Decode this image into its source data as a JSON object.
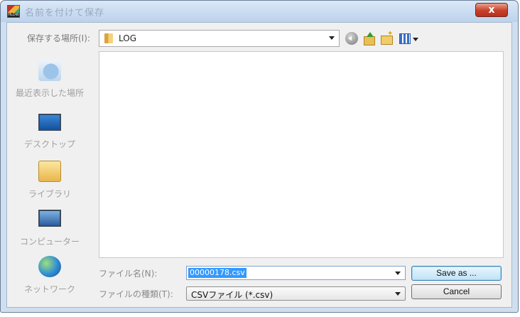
{
  "window": {
    "title": "名前を付けて保存",
    "app_icon_text": "HLDW",
    "close_label": "x"
  },
  "toolbar": {
    "save_in_label": "保存する場所(I):",
    "location_value": "LOG",
    "icons": [
      "back-icon",
      "up-folder-icon",
      "new-folder-icon",
      "views-menu-icon"
    ]
  },
  "places": [
    {
      "label": "最近表示した場所",
      "icon": "recent-places-icon"
    },
    {
      "label": "デスクトップ",
      "icon": "desktop-icon"
    },
    {
      "label": "ライブラリ",
      "icon": "library-icon"
    },
    {
      "label": "コンピューター",
      "icon": "computer-icon"
    },
    {
      "label": "ネットワーク",
      "icon": "network-icon"
    }
  ],
  "form": {
    "filename_label": "ファイル名(N):",
    "filename_value": "00000178.csv",
    "filetype_label": "ファイルの種類(T):",
    "filetype_value": "CSVファイル (*.csv)"
  },
  "buttons": {
    "save": "Save as ...",
    "cancel": "Cancel"
  },
  "colors": {
    "titlebar": "#c9dbf0",
    "close_button": "#c7402a",
    "selection": "#3399ff"
  }
}
